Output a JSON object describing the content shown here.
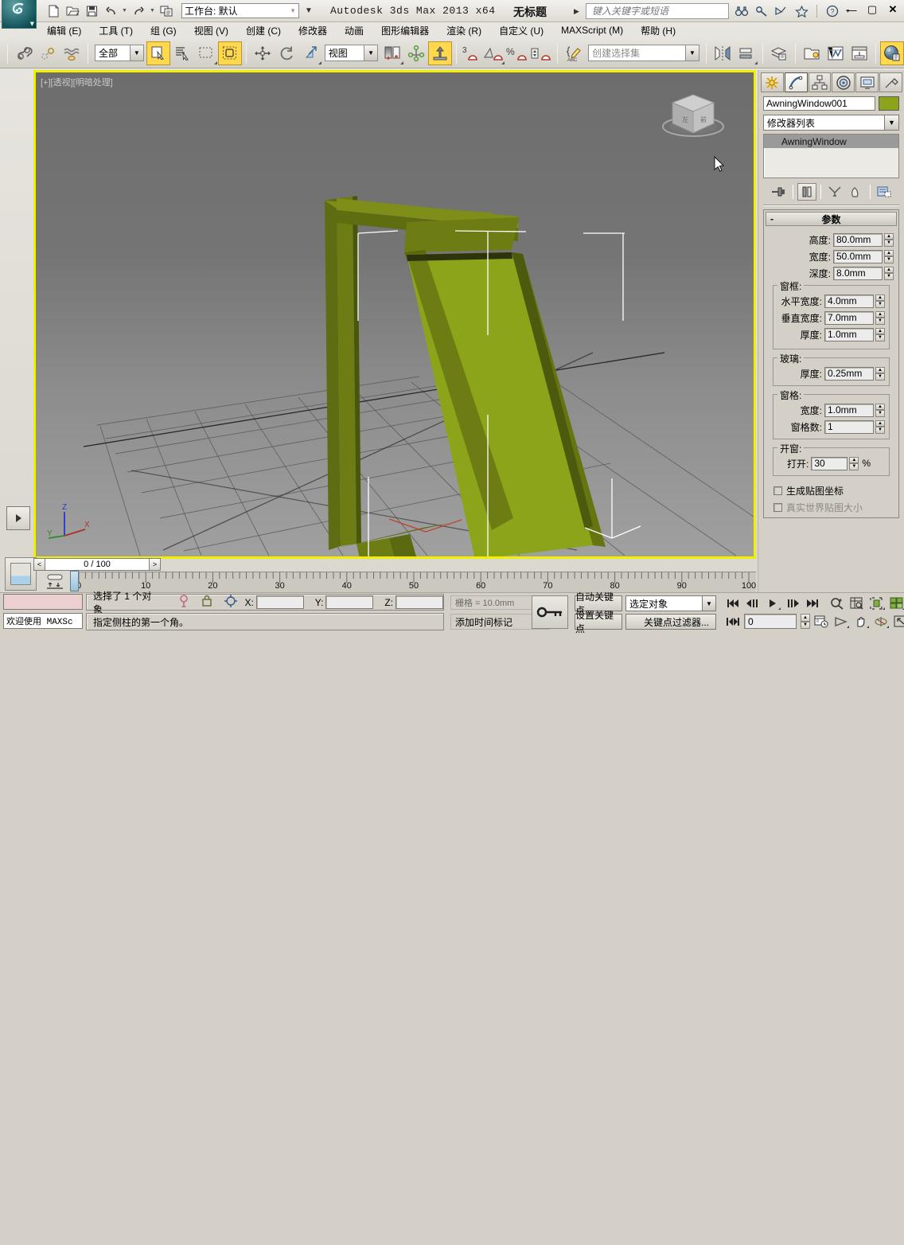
{
  "titlebar": {
    "app_title": "Autodesk 3ds Max  2013  x64",
    "document_title": "无标题",
    "workspace_label": "工作台: 默认",
    "search_placeholder": "键入关键字或短语",
    "quick_access": [
      {
        "name": "new-file-icon",
        "glyph": "⬚"
      },
      {
        "name": "open-file-icon",
        "glyph": "Ὄ2"
      },
      {
        "name": "save-file-icon",
        "glyph": "Ὃe"
      },
      {
        "name": "undo-icon",
        "glyph": "↶"
      },
      {
        "name": "redo-icon",
        "glyph": "↷"
      },
      {
        "name": "project-folder-icon",
        "glyph": "὜2"
      }
    ],
    "right_icons": [
      "binoculars-icon",
      "key-icon",
      "satellite-icon",
      "star-icon",
      "help-icon"
    ],
    "window_controls": [
      "minimize",
      "maximize",
      "close"
    ]
  },
  "menu": {
    "items": [
      "编辑 (E)",
      "工具 (T)",
      "组 (G)",
      "视图 (V)",
      "创建 (C)",
      "修改器",
      "动画",
      "图形编辑器",
      "渲染 (R)",
      "自定义 (U)",
      "MAXScript (M)",
      "帮助 (H)"
    ]
  },
  "toolbar": {
    "selection_filter": "全部",
    "reference_coord": "视图",
    "named_selection_sets": "创建选择集",
    "buttons": [
      "select-and-link-icon",
      "unlink-selection-icon",
      "bind-to-space-warp-icon",
      "select-object-icon",
      "select-by-name-icon",
      "rectangular-selection-region-icon",
      "window-crossing-icon",
      "select-and-move-icon",
      "select-and-rotate-icon",
      "select-and-scale-icon",
      "use-pivot-point-center-icon",
      "select-and-manipulate-icon",
      "snaps-toggle-icon",
      "angle-snap-toggle-icon",
      "percent-snap-toggle-icon",
      "spinner-snap-toggle-icon",
      "edit-named-selection-sets-icon",
      "mirror-icon",
      "align-icon",
      "layer-manager-icon",
      "toggle-scene-explorer-icon",
      "curve-editor-icon",
      "schematic-view-icon",
      "material-editor-icon"
    ]
  },
  "viewport": {
    "label": "[+][透视][明暗处理]",
    "axis_labels": [
      "Z",
      "X",
      "Y"
    ],
    "object_color": "#8ca41a",
    "background_top": "#6f6f6f",
    "background_bottom": "#9a9a9a"
  },
  "timeline": {
    "frame_display": "0 / 100",
    "prev_label": "<",
    "next_label": ">",
    "ticks": [
      0,
      10,
      20,
      30,
      40,
      50,
      60,
      70,
      80,
      90,
      100
    ],
    "range_start": 0,
    "range_end": 100,
    "current_frame": 0
  },
  "command_panel": {
    "tabs": [
      "create-tab-icon",
      "modify-tab-icon",
      "hierarchy-tab-icon",
      "motion-tab-icon",
      "display-tab-icon",
      "utilities-tab-icon"
    ],
    "selected_tab_index": 1,
    "object_name": "AwningWindow001",
    "object_color": "#8ca41a",
    "modifier_list_label": "修改器列表",
    "stack_items": [
      "AwningWindow"
    ],
    "stack_buttons": [
      "pin-stack-icon",
      "show-end-result-icon",
      "make-unique-icon",
      "remove-modifier-icon",
      "configure-modifier-sets-icon"
    ],
    "rollout": {
      "title": "参数",
      "collapse_sign": "-",
      "main_params": [
        {
          "label": "高度:",
          "value": "80.0mm"
        },
        {
          "label": "宽度:",
          "value": "50.0mm"
        },
        {
          "label": "深度:",
          "value": "8.0mm"
        }
      ],
      "groups": [
        {
          "title": "窗框:",
          "params": [
            {
              "label": "水平宽度:",
              "value": "4.0mm"
            },
            {
              "label": "垂直宽度:",
              "value": "7.0mm"
            },
            {
              "label": "厚度:",
              "value": "1.0mm"
            }
          ]
        },
        {
          "title": "玻璃:",
          "params": [
            {
              "label": "厚度:",
              "value": "0.25mm"
            }
          ]
        },
        {
          "title": "窗格:",
          "params": [
            {
              "label": "宽度:",
              "value": "1.0mm"
            },
            {
              "label": "窗格数:",
              "value": "1"
            }
          ]
        },
        {
          "title": "开窗:",
          "params": [
            {
              "label": "打开:",
              "value": "30",
              "suffix": "%"
            }
          ]
        }
      ],
      "checkboxes": [
        {
          "label": "生成贴图坐标",
          "checked": false,
          "disabled": false
        },
        {
          "label": "真实世界贴图大小",
          "checked": false,
          "disabled": true
        }
      ]
    }
  },
  "status_bar": {
    "maxscript_mini_listener": "",
    "maxscript_button": "欢迎使用 MAXSc",
    "selection_status": "选择了 1 个对象",
    "prompt": "指定侧柱的第一个角。",
    "coord_x_label": "X:",
    "coord_y_label": "Y:",
    "coord_z_label": "Z:",
    "coord_x_value": "",
    "coord_y_value": "",
    "coord_z_value": "",
    "grid_info": "栅格 = 10.0mm",
    "add_time_tag": "添加时间标记",
    "auto_key": "自动关键点",
    "set_key": "设置关键点",
    "key_filter_selection": "选定对象",
    "key_filters": "关键点过滤器...",
    "current_frame_value": "0",
    "playback_buttons": [
      "go-to-start-icon",
      "previous-frame-icon",
      "play-animation-icon",
      "next-frame-icon",
      "go-to-end-icon",
      "zoom-icon",
      "zoom-region-icon",
      "zoom-extents-icon",
      "zoom-extents-all-icon",
      "key-mode-toggle-icon",
      "time-configuration-icon",
      "field-of-view-icon",
      "pan-view-icon",
      "orbit-icon",
      "maximize-viewport-toggle-icon"
    ]
  }
}
